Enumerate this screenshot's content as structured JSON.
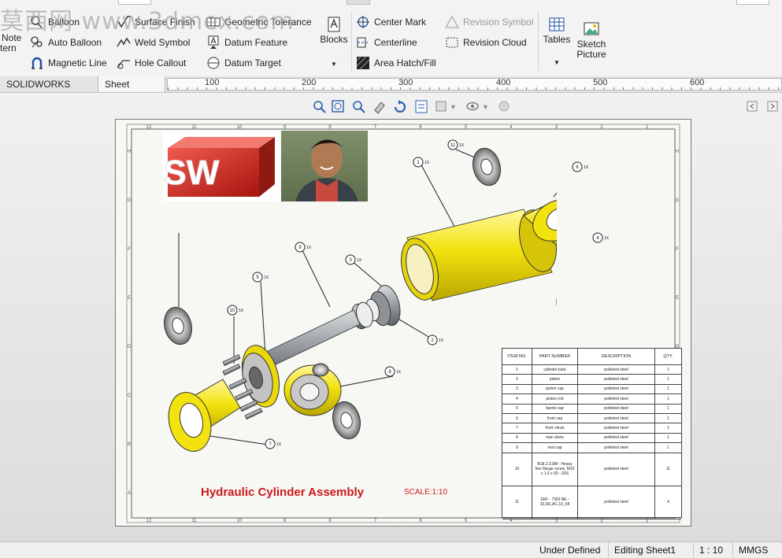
{
  "watermark": {
    "text": "莫西网 www.3dmex.com"
  },
  "ribbon": {
    "note_label": "Note",
    "pattern_label": "tern",
    "balloon_label": "Balloon",
    "auto_balloon_label": "Auto Balloon",
    "magnetic_line_label": "Magnetic Line",
    "surface_finish_label": "Surface Finish",
    "weld_symbol_label": "Weld Symbol",
    "hole_callout_label": "Hole Callout",
    "geometric_tolerance_label": "Geometric Tolerance",
    "datum_feature_label": "Datum Feature",
    "datum_target_label": "Datum Target",
    "blocks_label": "Blocks",
    "center_mark_label": "Center Mark",
    "centerline_label": "Centerline",
    "area_hatch_label": "Area Hatch/Fill",
    "revision_symbol_label": "Revision Symbol",
    "revision_cloud_label": "Revision Cloud",
    "tables_label": "Tables",
    "sketch_picture_label": "Sketch Picture"
  },
  "tabs": [
    {
      "label": "SOLIDWORKS Add-Ins"
    },
    {
      "label": "Sheet Format"
    }
  ],
  "ruler": {
    "ticks": [
      "100",
      "200",
      "300",
      "400",
      "500",
      "600"
    ]
  },
  "sheet": {
    "logo_text": "SW",
    "title": "Hydraulic Cylinder Assembly",
    "scale": "SCALE:1:10",
    "border_cols": [
      "12",
      "11",
      "10",
      "9",
      "8",
      "7",
      "6",
      "5",
      "4",
      "3",
      "2",
      "1"
    ],
    "border_rows": [
      "H",
      "G",
      "F",
      "E",
      "D",
      "C",
      "B",
      "A"
    ]
  },
  "balloons": [
    {
      "num": "1",
      "qty": "1X"
    },
    {
      "num": "2",
      "qty": "1X"
    },
    {
      "num": "3",
      "qty": "1X"
    },
    {
      "num": "4",
      "qty": "1X"
    },
    {
      "num": "5",
      "qty": "1X"
    },
    {
      "num": "6",
      "qty": "1X"
    },
    {
      "num": "7",
      "qty": "1X"
    },
    {
      "num": "8",
      "qty": "1X"
    },
    {
      "num": "9",
      "qty": "1X"
    },
    {
      "num": "10",
      "qty": "1X"
    },
    {
      "num": "11",
      "qty": "1X"
    }
  ],
  "bom": {
    "headers": [
      "ITEM NO.",
      "PART NUMBER",
      "DESCRIPTION",
      "QTY."
    ],
    "rows": [
      [
        "1",
        "cylinder tube",
        "polished steel",
        "1"
      ],
      [
        "2",
        "piston",
        "polished steel",
        "1"
      ],
      [
        "3",
        "piston cap",
        "polished steel",
        "1"
      ],
      [
        "4",
        "piston rod",
        "polished steel",
        "1"
      ],
      [
        "5",
        "barrel cap",
        "polished steel",
        "1"
      ],
      [
        "6",
        "front cap",
        "polished steel",
        "1"
      ],
      [
        "7",
        "front clevis",
        "polished steel",
        "1"
      ],
      [
        "8",
        "rear clevis",
        "polished steel",
        "1"
      ],
      [
        "9",
        "end cap",
        "polished steel",
        "1"
      ],
      [
        "10",
        "B18.2.3.9M - Heavy hex flange screw, M10 x 1.5 x 50 --26S",
        "polished steel",
        "11"
      ],
      [
        "11",
        "SKF - 7303 BE - 10,DE,AC,10_68",
        "polished steel",
        "4"
      ]
    ]
  },
  "status": {
    "state": "Under Defined",
    "mode": "Editing Sheet1",
    "scale": "1 : 10",
    "units": "MMGS"
  },
  "colors": {
    "yellow": "#f2e20d",
    "steel": "#9aa0a4",
    "title_red": "#cc1a1a",
    "logo_red": "#d5241e"
  }
}
